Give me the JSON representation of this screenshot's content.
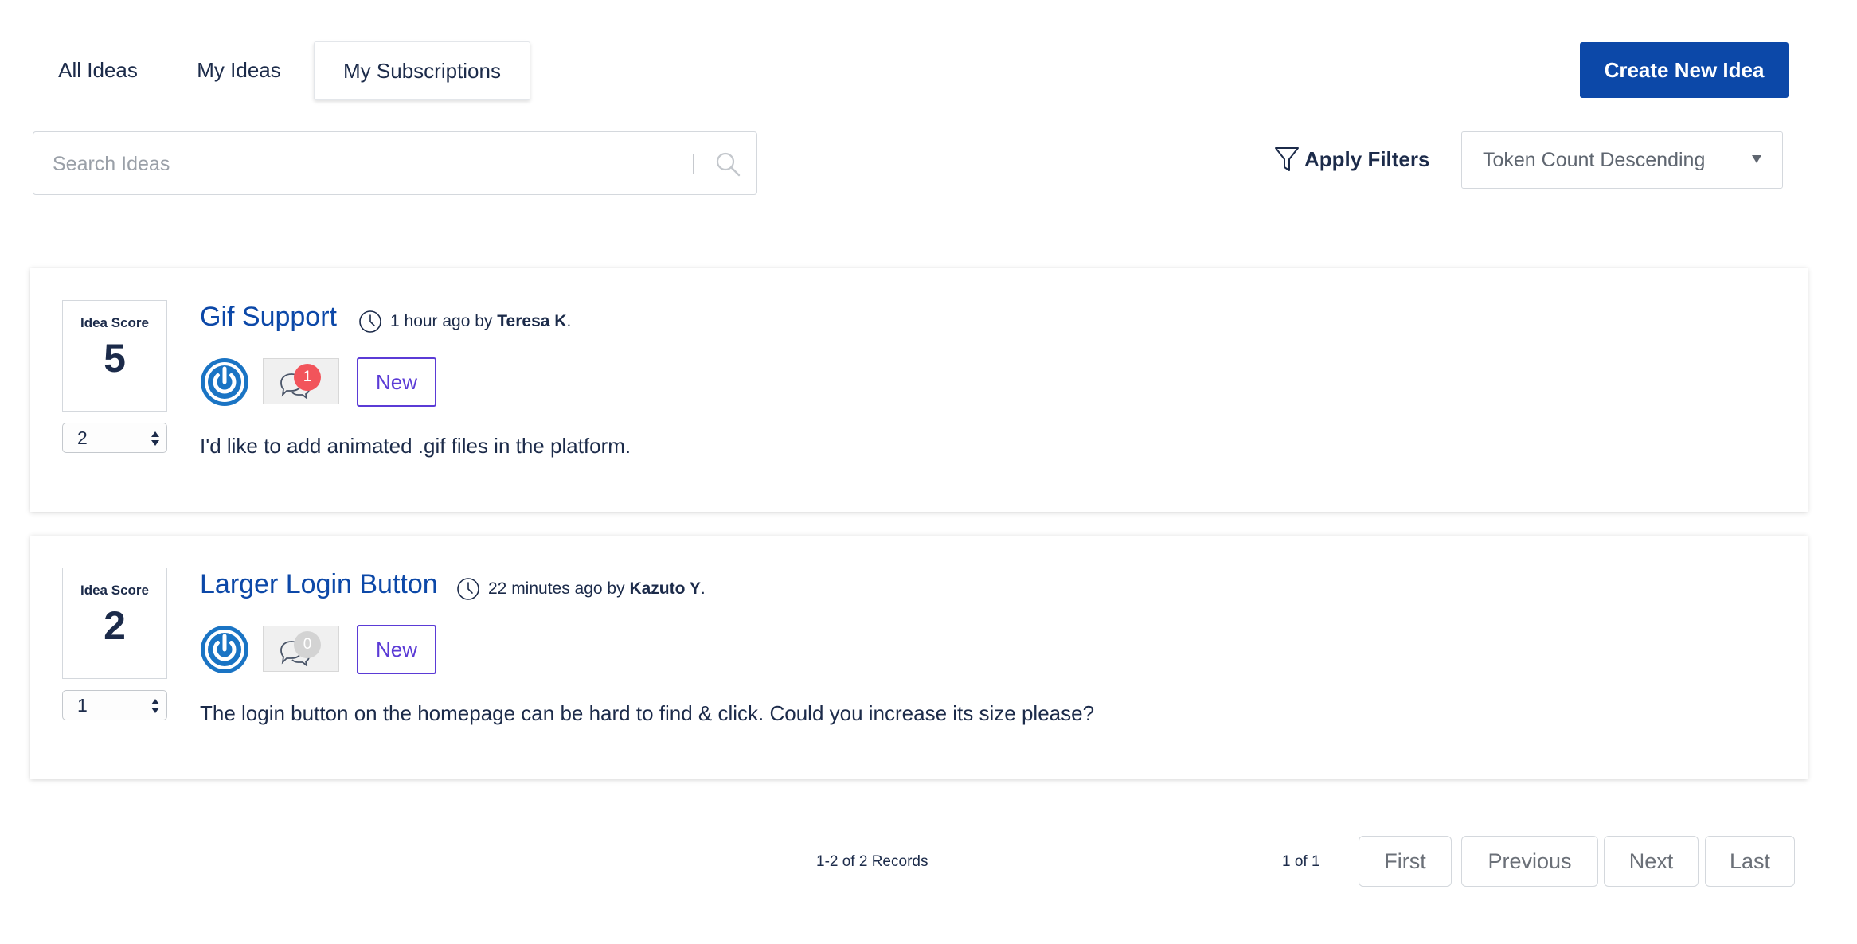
{
  "tabs": [
    {
      "label": "All Ideas",
      "active": false
    },
    {
      "label": "My Ideas",
      "active": false
    },
    {
      "label": "My Subscriptions",
      "active": true
    }
  ],
  "create_button": {
    "label": "Create New Idea"
  },
  "search": {
    "placeholder": "Search Ideas",
    "value": ""
  },
  "filters": {
    "label": "Apply Filters"
  },
  "sort": {
    "selected": "Token Count Descending"
  },
  "ideas": [
    {
      "score_label": "Idea Score",
      "score": "5",
      "vote_value": "2",
      "title": "Gif Support",
      "time": "1 hour ago by",
      "author": "Teresa K",
      "comment_count": "1",
      "status": "New",
      "description": "I'd like to add animated .gif files in the platform."
    },
    {
      "score_label": "Idea Score",
      "score": "2",
      "vote_value": "1",
      "title": "Larger Login Button",
      "time": "22 minutes ago by",
      "author": "Kazuto Y",
      "comment_count": "0",
      "status": "New",
      "description": "The login button on the homepage can be hard to find & click. Could you increase its size please?"
    }
  ],
  "pagination": {
    "records": "1-2 of 2 Records",
    "page_of": "1 of 1",
    "first": "First",
    "previous": "Previous",
    "next": "Next",
    "last": "Last"
  },
  "colors": {
    "primary": "#0c48a8",
    "status_new": "#5b3bd6",
    "badge_active": "#f2545b",
    "badge_empty": "#d3d3d3",
    "text": "#1c2b4a"
  }
}
